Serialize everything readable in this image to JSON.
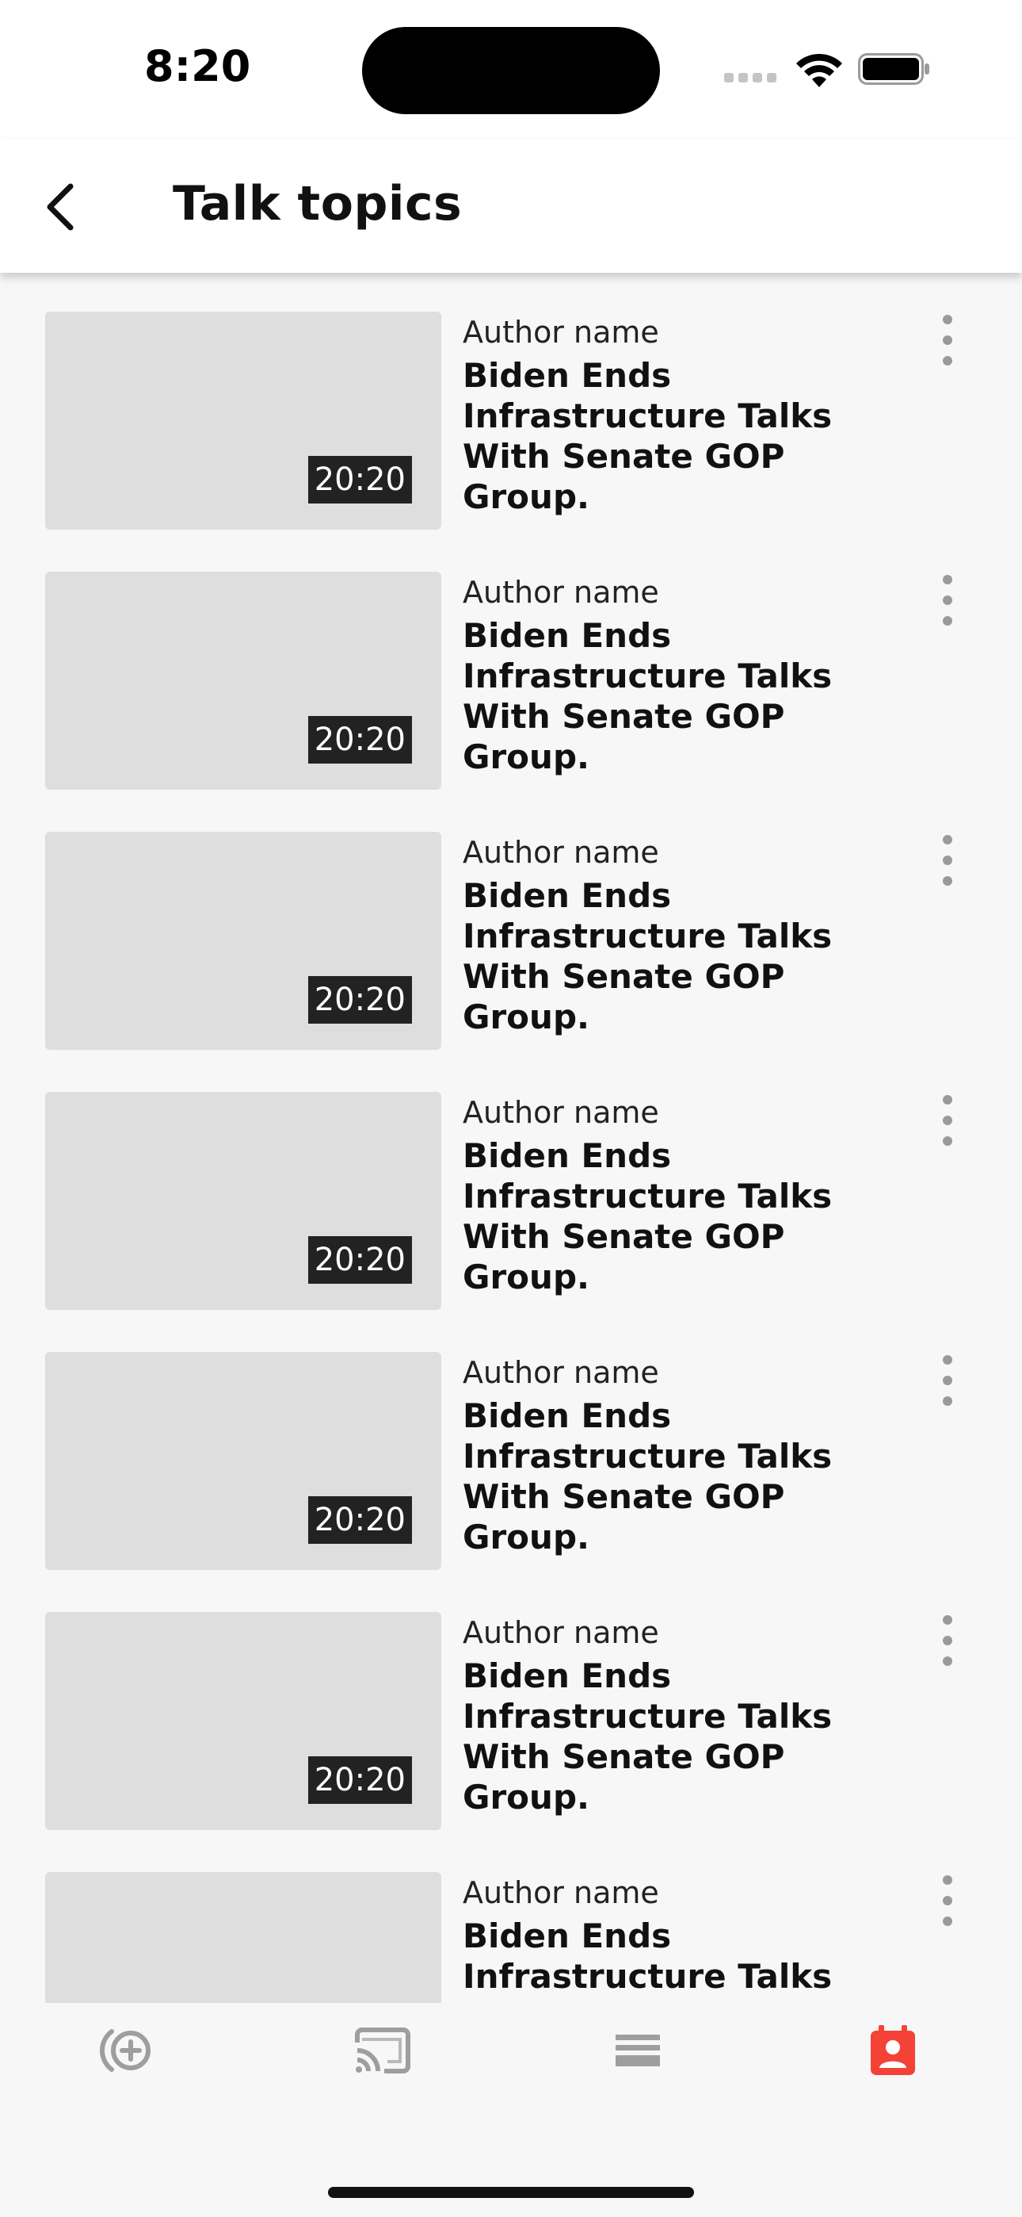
{
  "status_bar": {
    "time": "8:20"
  },
  "header": {
    "title": "Talk topics",
    "back_icon": "chevron-left-icon"
  },
  "items": [
    {
      "author": "Author name",
      "title": "Biden Ends Infrastructure Talks With Senate GOP Group.",
      "duration": "20:20"
    },
    {
      "author": "Author name",
      "title": "Biden Ends Infrastructure Talks With Senate GOP Group.",
      "duration": "20:20"
    },
    {
      "author": "Author name",
      "title": "Biden Ends Infrastructure Talks With Senate GOP Group.",
      "duration": "20:20"
    },
    {
      "author": "Author name",
      "title": "Biden Ends Infrastructure Talks With Senate GOP Group.",
      "duration": "20:20"
    },
    {
      "author": "Author name",
      "title": "Biden Ends Infrastructure Talks With Senate GOP Group.",
      "duration": "20:20"
    },
    {
      "author": "Author name",
      "title": "Biden Ends Infrastructure Talks With Senate GOP Group.",
      "duration": "20:20"
    },
    {
      "author": "Author name",
      "title": "Biden Ends Infrastructure Talks With Senate GOP Group.",
      "duration": ""
    }
  ],
  "bottom_nav": [
    {
      "icon": "add-podcast-icon",
      "active": false
    },
    {
      "icon": "cast-icon",
      "active": false
    },
    {
      "icon": "list-icon",
      "active": false
    },
    {
      "icon": "contact-calendar-icon",
      "active": true
    }
  ],
  "colors": {
    "accent": "#f44336",
    "inactive_icon": "#9e9e9e",
    "thumbnail": "#dedede",
    "badge": "#222222",
    "background": "#f7f7f7"
  }
}
